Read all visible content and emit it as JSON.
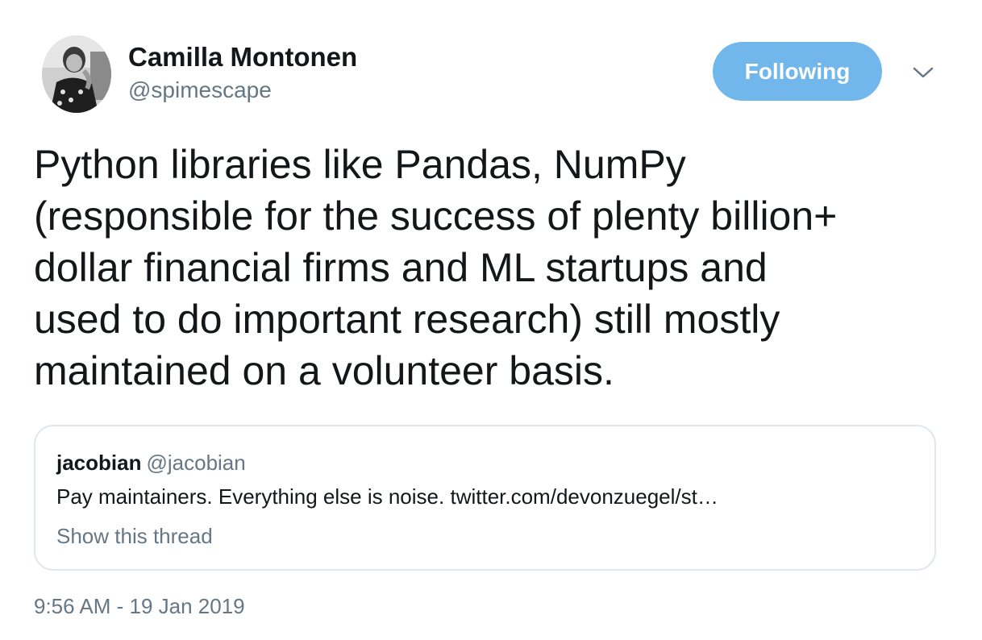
{
  "author": {
    "display_name": "Camilla Montonen",
    "handle": "@spimescape"
  },
  "follow_button": {
    "label": "Following"
  },
  "tweet": {
    "text": "Python libraries like Pandas, NumPy\n(responsible for the success of plenty billion+\ndollar financial firms and ML startups and\nused to do important research) still mostly\nmaintained on a volunteer basis.",
    "timestamp": "9:56 AM - 19 Jan 2019"
  },
  "quoted_tweet": {
    "display_name": "jacobian",
    "handle": "@jacobian",
    "text": "Pay maintainers. Everything else is noise.",
    "link": "twitter.com/devonzuegel/st…",
    "show_thread": "Show this thread"
  },
  "icons": {
    "more": "chevron-down-icon"
  },
  "colors": {
    "follow_button_bg": "#71b7ec",
    "secondary_text": "#657786",
    "primary_text": "#14171a",
    "card_border": "#e1e8ed"
  }
}
